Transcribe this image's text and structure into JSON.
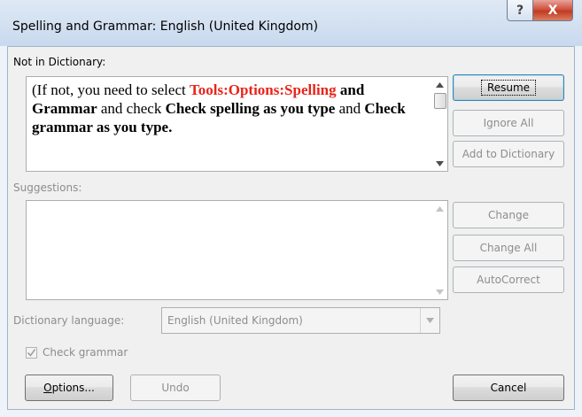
{
  "window": {
    "title": "Spelling and Grammar: English (United Kingdom)",
    "help_label": "?",
    "close_label": "X"
  },
  "not_in_dictionary": {
    "label": "Not in Dictionary:",
    "text_parts": [
      {
        "text": "(If not, you need to select ",
        "style": "normal"
      },
      {
        "text": "Tools:Options:Spelling",
        "style": "red"
      },
      {
        "text": " ",
        "style": "normal"
      },
      {
        "text": "and Grammar",
        "style": "bold"
      },
      {
        "text": " and check ",
        "style": "normal"
      },
      {
        "text": "Check spelling as you type",
        "style": "bold"
      },
      {
        "text": " and ",
        "style": "normal"
      },
      {
        "text": "Check grammar as you type.",
        "style": "bold"
      }
    ]
  },
  "suggestions": {
    "label": "Suggestions:",
    "items": []
  },
  "buttons": {
    "resume": "Resume",
    "ignore_all": "Ignore All",
    "add_to_dictionary": "Add to Dictionary",
    "change": "Change",
    "change_all": "Change All",
    "autocorrect": "AutoCorrect",
    "options": "Options...",
    "undo": "Undo",
    "cancel": "Cancel"
  },
  "dictionary_language": {
    "label": "Dictionary language:",
    "value": "English (United Kingdom)"
  },
  "check_grammar": {
    "label": "Check grammar",
    "checked": true
  },
  "colors": {
    "highlight_red": "#e8241a",
    "title_bar": "#d3e1f1",
    "close_button": "#c23a22"
  }
}
